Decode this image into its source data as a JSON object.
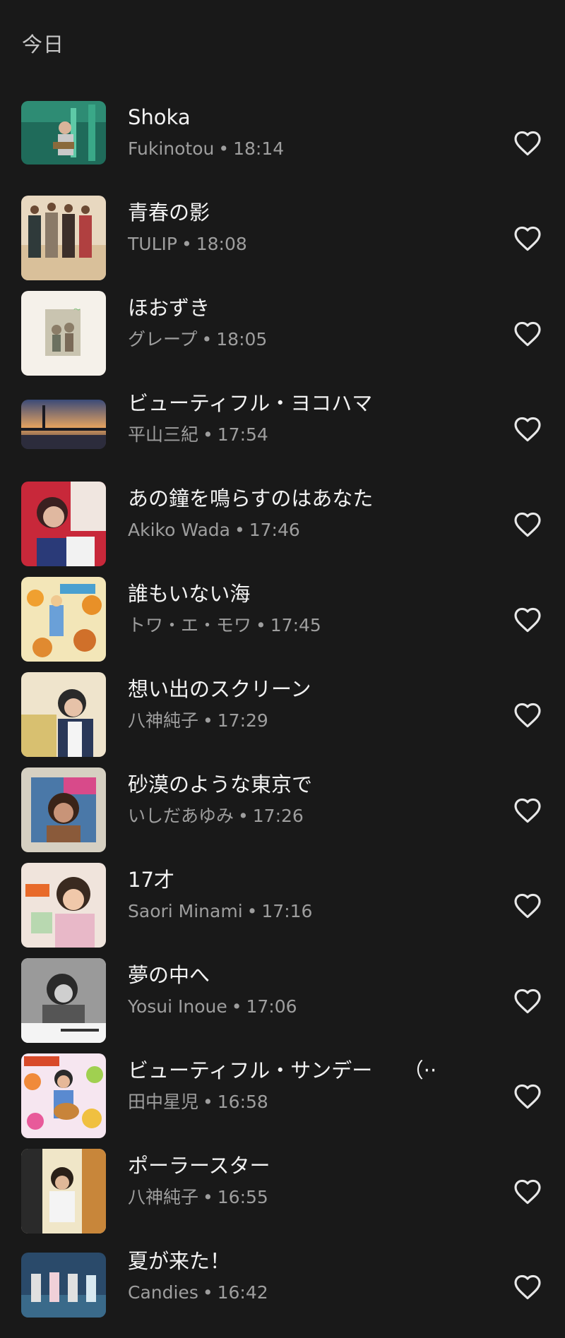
{
  "section": {
    "title": "今日"
  },
  "tracks": [
    {
      "title": "Shoka",
      "artist": "Fukinotou",
      "time": "18:14"
    },
    {
      "title": "青春の影",
      "artist": "TULIP",
      "time": "18:08"
    },
    {
      "title": "ほおずき",
      "artist": "グレープ",
      "time": "18:05"
    },
    {
      "title": "ビューティフル・ヨコハマ",
      "artist": "平山三紀",
      "time": "17:54"
    },
    {
      "title": "あの鐘を鳴らすのはあなた",
      "artist": "Akiko Wada",
      "time": "17:46"
    },
    {
      "title": "誰もいない海",
      "artist": "トワ・エ・モワ",
      "time": "17:45"
    },
    {
      "title": "想い出のスクリーン",
      "artist": "八神純子",
      "time": "17:29"
    },
    {
      "title": "砂漠のような東京で",
      "artist": "いしだあゆみ",
      "time": "17:26"
    },
    {
      "title": "17才",
      "artist": "Saori Minami",
      "time": "17:16"
    },
    {
      "title": "夢の中へ",
      "artist": "Yosui Inoue",
      "time": "17:06"
    },
    {
      "title": "ビューティフル・サンデー　　（··",
      "artist": "田中星児",
      "time": "16:58"
    },
    {
      "title": "ポーラースター",
      "artist": "八神純子",
      "time": "16:55"
    },
    {
      "title": "夏が来た！",
      "artist": "Candies",
      "time": "16:42"
    }
  ],
  "separator": "•",
  "icons": {
    "favorite": "heart-outline-icon"
  },
  "colors": {
    "background": "#191919",
    "title": "#f2f2f2",
    "subtitle": "#9e9e9e",
    "icon": "#e8e8e8"
  }
}
